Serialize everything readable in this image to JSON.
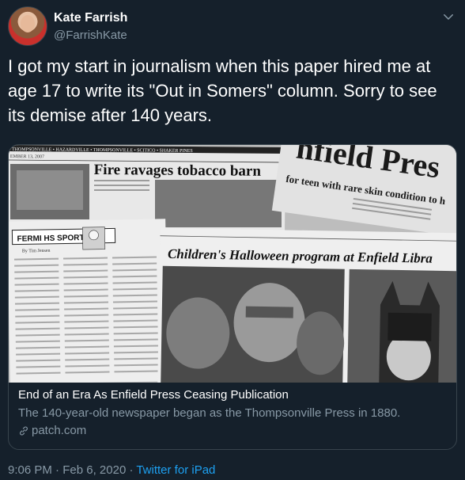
{
  "author": {
    "name": "Kate Farrish",
    "handle": "@FarrishKate",
    "avatar_icon": "profile-photo"
  },
  "tweet": {
    "text": "I got my start in journalism when this paper hired me at age 17 to write its \"Out in Somers\" column. Sorry to see its demise after 140 years."
  },
  "card": {
    "image_icon": "newspaper-clippings-photo",
    "image_text": {
      "masthead": "THOMPSONVILLE • HAZARDVILLE • THOMPSONVILLE • SCITICO • SHAKER PINES",
      "date_line": "EMBER 13, 2007",
      "headline_1": "Fire ravages tobacco barn",
      "paper_name": "nfield Pres",
      "subhead": "for teen with rare skin condition to h",
      "sports_head": "FERMI HS SPORTS",
      "byline": "By Tim Jensen",
      "headline_2": "Children's Halloween program at Enfield Libra"
    },
    "title": "End of an Era As Enfield Press Ceasing Publication",
    "description": "The 140-year-old newspaper began as the Thompsonville Press in 1880.",
    "domain": "patch.com",
    "link_icon": "link-icon"
  },
  "footer": {
    "time": "9:06 PM",
    "separator_1": " · ",
    "date": "Feb 6, 2020",
    "separator_2": " · ",
    "source": "Twitter for iPad"
  },
  "colors": {
    "background": "#15202b",
    "secondary_text": "#8899a6",
    "link": "#1da1f2",
    "border": "#38444d"
  }
}
